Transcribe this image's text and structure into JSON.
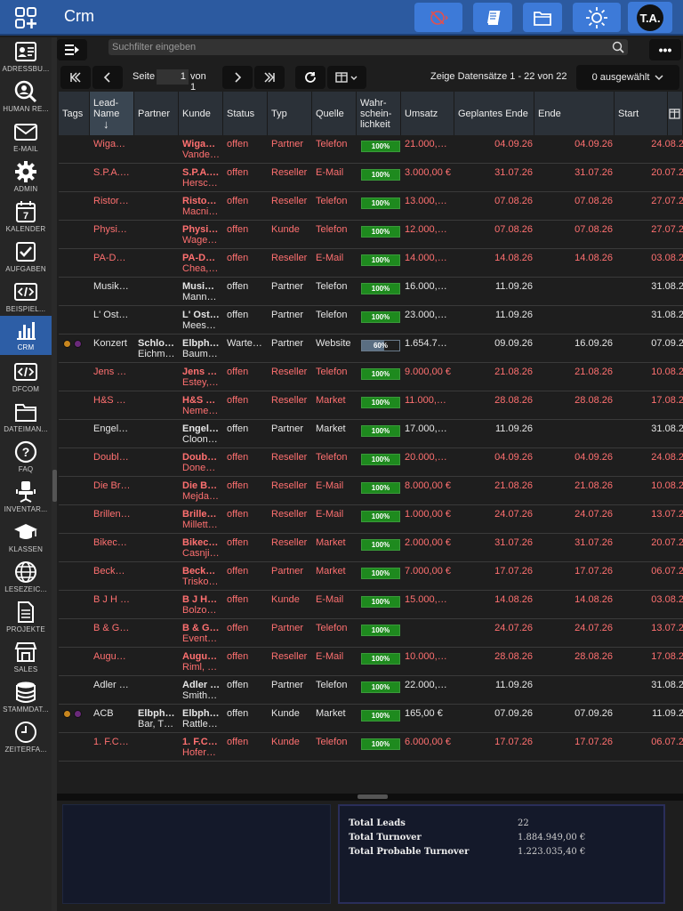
{
  "app": {
    "title": "Crm",
    "avatar_initials": "T.A."
  },
  "sidebar": {
    "items": [
      {
        "label": "ADRESSBU...",
        "icon": "address-book-icon"
      },
      {
        "label": "HUMAN RE...",
        "icon": "person-search-icon"
      },
      {
        "label": "E-MAIL",
        "icon": "mail-icon"
      },
      {
        "label": "ADMIN",
        "icon": "gear-icon"
      },
      {
        "label": "KALENDER",
        "icon": "calendar-icon"
      },
      {
        "label": "AUFGABEN",
        "icon": "checkbox-icon"
      },
      {
        "label": "BEISPIEL...",
        "icon": "code-icon"
      },
      {
        "label": "CRM",
        "icon": "bar-chart-icon"
      },
      {
        "label": "DFCOM",
        "icon": "code-icon"
      },
      {
        "label": "DATEIMAN...",
        "icon": "folder-icon"
      },
      {
        "label": "FAQ",
        "icon": "question-icon"
      },
      {
        "label": "INVENTAR...",
        "icon": "chair-icon"
      },
      {
        "label": "KLASSEN",
        "icon": "graduation-cap-icon"
      },
      {
        "label": "LESEZEIC...",
        "icon": "globe-icon"
      },
      {
        "label": "PROJEKTE",
        "icon": "document-icon"
      },
      {
        "label": "SALES",
        "icon": "store-icon"
      },
      {
        "label": "STAMMDAT...",
        "icon": "database-icon"
      },
      {
        "label": "ZEITERFA...",
        "icon": "clock-icon"
      }
    ]
  },
  "toolbar": {
    "search_placeholder": "Suchfilter eingeben",
    "more_label": "•••"
  },
  "pager": {
    "page_label": "Seite",
    "page_value": "1",
    "of_label": "von 1",
    "records_text": "Zeige Datensätze 1 - 22 von 22",
    "selected_label": "0 ausgewählt"
  },
  "columns": {
    "tags": "Tags",
    "lead_name_1": "Lead-",
    "lead_name_2": "Name",
    "sort_arrow": "↓",
    "partner": "Partner",
    "kunde": "Kunde",
    "status": "Status",
    "typ": "Typ",
    "quelle": "Quelle",
    "wahr_1": "Wahr-",
    "wahr_2": "schein-",
    "wahr_3": "lichkeit",
    "umsatz": "Umsatz",
    "geplantes_ende": "Geplantes Ende",
    "ende": "Ende",
    "start": "Start"
  },
  "rows": [
    {
      "lead": "Wiga…",
      "partner": "",
      "partner2": "",
      "kunde": "Wiga…",
      "kunde2": "Vande…",
      "status": "offen",
      "typ": "Partner",
      "quelle": "Telefon",
      "prob": "100%",
      "prob_value": 1.0,
      "umsatz": "21.000,…",
      "geplant": "04.09.26",
      "ende": "04.09.26",
      "start": "24.08.2",
      "red": true,
      "tags": false
    },
    {
      "lead": "S.P.A.…",
      "partner": "",
      "partner2": "",
      "kunde": "S.P.A.…",
      "kunde2": "Hersc…",
      "status": "offen",
      "typ": "Reseller",
      "quelle": "E-Mail",
      "prob": "100%",
      "prob_value": 1.0,
      "umsatz": "3.000,00 €",
      "geplant": "31.07.26",
      "ende": "31.07.26",
      "start": "20.07.2",
      "red": true,
      "tags": false
    },
    {
      "lead": "Ristor…",
      "partner": "",
      "partner2": "",
      "kunde": "Risto…",
      "kunde2": "Macni…",
      "status": "offen",
      "typ": "Reseller",
      "quelle": "Telefon",
      "prob": "100%",
      "prob_value": 1.0,
      "umsatz": "13.000,…",
      "geplant": "07.08.26",
      "ende": "07.08.26",
      "start": "27.07.2",
      "red": true,
      "tags": false
    },
    {
      "lead": "Physi…",
      "partner": "",
      "partner2": "",
      "kunde": "Physi…",
      "kunde2": "Wage…",
      "status": "offen",
      "typ": "Kunde",
      "quelle": "Telefon",
      "prob": "100%",
      "prob_value": 1.0,
      "umsatz": "12.000,…",
      "geplant": "07.08.26",
      "ende": "07.08.26",
      "start": "27.07.2",
      "red": true,
      "tags": false
    },
    {
      "lead": "PA-D…",
      "partner": "",
      "partner2": "",
      "kunde": "PA-D…",
      "kunde2": "Chea,…",
      "status": "offen",
      "typ": "Reseller",
      "quelle": "E-Mail",
      "prob": "100%",
      "prob_value": 1.0,
      "umsatz": "14.000,…",
      "geplant": "14.08.26",
      "ende": "14.08.26",
      "start": "03.08.2",
      "red": true,
      "tags": false
    },
    {
      "lead": "Musik…",
      "partner": "",
      "partner2": "",
      "kunde": "Musi…",
      "kunde2": "Mann…",
      "status": "offen",
      "typ": "Partner",
      "quelle": "Telefon",
      "prob": "100%",
      "prob_value": 1.0,
      "umsatz": "16.000,…",
      "geplant": "11.09.26",
      "ende": "",
      "start": "31.08.2",
      "red": false,
      "tags": false
    },
    {
      "lead": "L' Ost…",
      "partner": "",
      "partner2": "",
      "kunde": "L' Ost…",
      "kunde2": "Mees…",
      "status": "offen",
      "typ": "Partner",
      "quelle": "Telefon",
      "prob": "100%",
      "prob_value": 1.0,
      "umsatz": "23.000,…",
      "geplant": "11.09.26",
      "ende": "",
      "start": "31.08.2",
      "red": false,
      "tags": false
    },
    {
      "lead": "Konzert",
      "partner": "Schlo…",
      "partner2": "Eichm…",
      "kunde": "Elbph…",
      "kunde2": "Baum…",
      "status": "Warte…",
      "typ": "Partner",
      "quelle": "Website",
      "prob": "60%",
      "prob_value": 0.6,
      "umsatz": "1.654.7…",
      "geplant": "09.09.26",
      "ende": "16.09.26",
      "start": "07.09.2",
      "red": false,
      "tags": true
    },
    {
      "lead": "Jens …",
      "partner": "",
      "partner2": "",
      "kunde": "Jens …",
      "kunde2": "Estey,…",
      "status": "offen",
      "typ": "Reseller",
      "quelle": "Telefon",
      "prob": "100%",
      "prob_value": 1.0,
      "umsatz": "9.000,00 €",
      "geplant": "21.08.26",
      "ende": "21.08.26",
      "start": "10.08.2",
      "red": true,
      "tags": false
    },
    {
      "lead": "H&S …",
      "partner": "",
      "partner2": "",
      "kunde": "H&S …",
      "kunde2": "Neme…",
      "status": "offen",
      "typ": "Reseller",
      "quelle": "Market",
      "prob": "100%",
      "prob_value": 1.0,
      "umsatz": "11.000,…",
      "geplant": "28.08.26",
      "ende": "28.08.26",
      "start": "17.08.2",
      "red": true,
      "tags": false
    },
    {
      "lead": "Engel…",
      "partner": "",
      "partner2": "",
      "kunde": "Engel…",
      "kunde2": "Cloon…",
      "status": "offen",
      "typ": "Partner",
      "quelle": "Market",
      "prob": "100%",
      "prob_value": 1.0,
      "umsatz": "17.000,…",
      "geplant": "11.09.26",
      "ende": "",
      "start": "31.08.2",
      "red": false,
      "tags": false
    },
    {
      "lead": "Doubl…",
      "partner": "",
      "partner2": "",
      "kunde": "Doub…",
      "kunde2": "Done…",
      "status": "offen",
      "typ": "Reseller",
      "quelle": "Telefon",
      "prob": "100%",
      "prob_value": 1.0,
      "umsatz": "20.000,…",
      "geplant": "04.09.26",
      "ende": "04.09.26",
      "start": "24.08.2",
      "red": true,
      "tags": false
    },
    {
      "lead": "Die Br…",
      "partner": "",
      "partner2": "",
      "kunde": "Die B…",
      "kunde2": "Mejda…",
      "status": "offen",
      "typ": "Reseller",
      "quelle": "E-Mail",
      "prob": "100%",
      "prob_value": 1.0,
      "umsatz": "8.000,00 €",
      "geplant": "21.08.26",
      "ende": "21.08.26",
      "start": "10.08.2",
      "red": true,
      "tags": false
    },
    {
      "lead": "Brillen…",
      "partner": "",
      "partner2": "",
      "kunde": "Brille…",
      "kunde2": "Millett…",
      "status": "offen",
      "typ": "Reseller",
      "quelle": "E-Mail",
      "prob": "100%",
      "prob_value": 1.0,
      "umsatz": "1.000,00 €",
      "geplant": "24.07.26",
      "ende": "24.07.26",
      "start": "13.07.2",
      "red": true,
      "tags": false
    },
    {
      "lead": "Bikec…",
      "partner": "",
      "partner2": "",
      "kunde": "Bikec…",
      "kunde2": "Casnji…",
      "status": "offen",
      "typ": "Reseller",
      "quelle": "Market",
      "prob": "100%",
      "prob_value": 1.0,
      "umsatz": "2.000,00 €",
      "geplant": "31.07.26",
      "ende": "31.07.26",
      "start": "20.07.2",
      "red": true,
      "tags": false
    },
    {
      "lead": "Beck…",
      "partner": "",
      "partner2": "",
      "kunde": "Beck…",
      "kunde2": "Trisko…",
      "status": "offen",
      "typ": "Partner",
      "quelle": "Market",
      "prob": "100%",
      "prob_value": 1.0,
      "umsatz": "7.000,00 €",
      "geplant": "17.07.26",
      "ende": "17.07.26",
      "start": "06.07.2",
      "red": true,
      "tags": false
    },
    {
      "lead": "B J H …",
      "partner": "",
      "partner2": "",
      "kunde": "B J H…",
      "kunde2": "Bolzo…",
      "status": "offen",
      "typ": "Kunde",
      "quelle": "E-Mail",
      "prob": "100%",
      "prob_value": 1.0,
      "umsatz": "15.000,…",
      "geplant": "14.08.26",
      "ende": "14.08.26",
      "start": "03.08.2",
      "red": true,
      "tags": false
    },
    {
      "lead": "B & G…",
      "partner": "",
      "partner2": "",
      "kunde": "B & G…",
      "kunde2": "Event…",
      "status": "offen",
      "typ": "Partner",
      "quelle": "Telefon",
      "prob": "100%",
      "prob_value": 1.0,
      "umsatz": "",
      "geplant": "24.07.26",
      "ende": "24.07.26",
      "start": "13.07.2",
      "red": true,
      "tags": false
    },
    {
      "lead": "Augu…",
      "partner": "",
      "partner2": "",
      "kunde": "Augu…",
      "kunde2": "Riml, …",
      "status": "offen",
      "typ": "Reseller",
      "quelle": "E-Mail",
      "prob": "100%",
      "prob_value": 1.0,
      "umsatz": "10.000,…",
      "geplant": "28.08.26",
      "ende": "28.08.26",
      "start": "17.08.2",
      "red": true,
      "tags": false
    },
    {
      "lead": "Adler …",
      "partner": "",
      "partner2": "",
      "kunde": "Adler …",
      "kunde2": "Smith…",
      "status": "offen",
      "typ": "Partner",
      "quelle": "Telefon",
      "prob": "100%",
      "prob_value": 1.0,
      "umsatz": "22.000,…",
      "geplant": "11.09.26",
      "ende": "",
      "start": "31.08.2",
      "red": false,
      "tags": false
    },
    {
      "lead": "ACB",
      "partner": "Elbph…",
      "partner2": "Bar, T…",
      "kunde": "Elbph…",
      "kunde2": "Rattle…",
      "status": "offen",
      "typ": "Kunde",
      "quelle": "Market",
      "prob": "100%",
      "prob_value": 1.0,
      "umsatz": "165,00 €",
      "geplant": "07.09.26",
      "ende": "07.09.26",
      "start": "11.09.2",
      "red": false,
      "tags": true
    },
    {
      "lead": "1. F.C…",
      "partner": "",
      "partner2": "",
      "kunde": "1. F.C…",
      "kunde2": "Hofer…",
      "status": "offen",
      "typ": "Kunde",
      "quelle": "Telefon",
      "prob": "100%",
      "prob_value": 1.0,
      "umsatz": "6.000,00 €",
      "geplant": "17.07.26",
      "ende": "17.07.26",
      "start": "06.07.2",
      "red": true,
      "tags": false
    }
  ],
  "stats": [
    {
      "label": "Total Leads",
      "value": "22"
    },
    {
      "label": "Total Turnover",
      "value": "1.884.949,00 €"
    },
    {
      "label": "Total Probable Turnover",
      "value": "1.223.035,40 €"
    }
  ],
  "colors": {
    "topbar": "#2c5aa0",
    "accent_button": "#3d7ad8",
    "overdue_text": "#ff7070",
    "prob_fill": "#1e8a1e",
    "tag_orange": "#c8861e",
    "tag_purple": "#6a2a7a"
  }
}
